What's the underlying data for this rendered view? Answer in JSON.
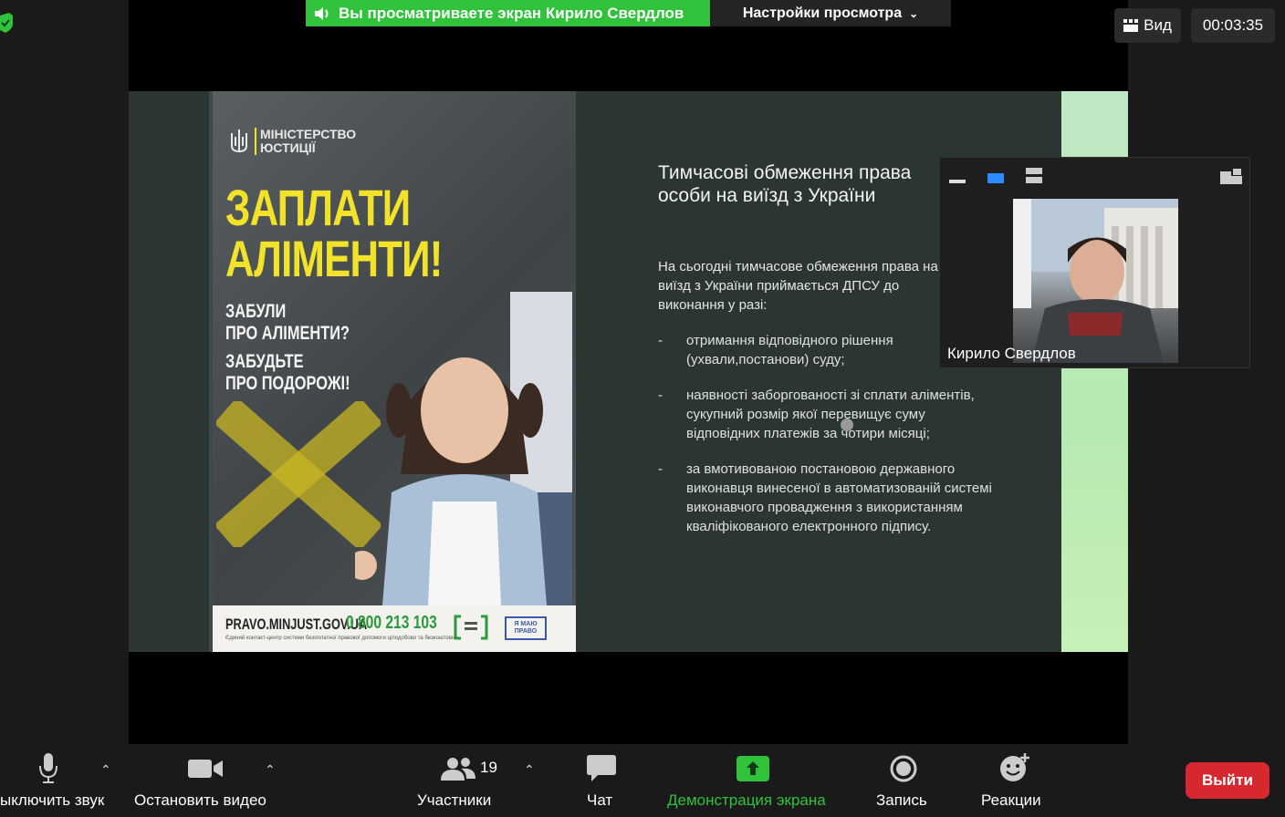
{
  "banner": {
    "sharing_text": "Вы просматриваете экран Кирило Свердлов",
    "view_settings_label": "Настройки просмотра"
  },
  "top_right": {
    "view_label": "Вид",
    "timer": "00:03:35"
  },
  "slide": {
    "poster": {
      "ministry_line1": "МІНІСТЕРСТВО",
      "ministry_line2": "ЮСТИЦІЇ",
      "headline_line1": "ЗАПЛАТИ",
      "headline_line2": "АЛІМЕНТИ!",
      "sub1_line1": "ЗАБУЛИ",
      "sub1_line2": "ПРО АЛІМЕНТИ?",
      "sub2_line1": "ЗАБУДЬТЕ",
      "sub2_line2": "ПРО ПОДОРОЖІ!",
      "site": "PRAVO.MINJUST.GOV.UA",
      "phone": "0 800 213 103",
      "footnote": "Єдиний контакт-центр системи безоплатної правової допомоги цілодобово та безкоштовно",
      "logo2_text": "Я МАЮ ПРАВО"
    },
    "title": "Тимчасові обмеження права особи на виїзд з України",
    "intro": "На сьогодні тимчасове обмеження права на виїзд з України приймається ДПСУ до виконання у разі:",
    "bullets": [
      {
        "dash": "-",
        "text": "отримання відповідного рішення (ухвали,постанови) суду;"
      },
      {
        "dash": "-",
        "text": "наявності заборгованості зі сплати аліментів, сукупний розмір якої перевищує суму відповідних платежів за чотири місяці;"
      },
      {
        "dash": "-",
        "text": "за вмотивованою постановою державного виконавця винесеної в автоматизованій системі виконавчого провадження з використанням кваліфікованого електронного підпису."
      }
    ]
  },
  "video": {
    "participant_name": "Кирило Свердлов"
  },
  "toolbar": {
    "mute_label": "ыключить звук",
    "video_label": "Остановить видео",
    "participants_label": "Участники",
    "participants_count": "19",
    "chat_label": "Чат",
    "share_label": "Демонстрация экрана",
    "record_label": "Запись",
    "reactions_label": "Реакции",
    "leave_label": "Выйти"
  },
  "colors": {
    "share_green": "#2fc23a",
    "leave_red": "#d6282e",
    "poster_yellow": "#f2e32a",
    "phone_green": "#2a9a3a"
  }
}
